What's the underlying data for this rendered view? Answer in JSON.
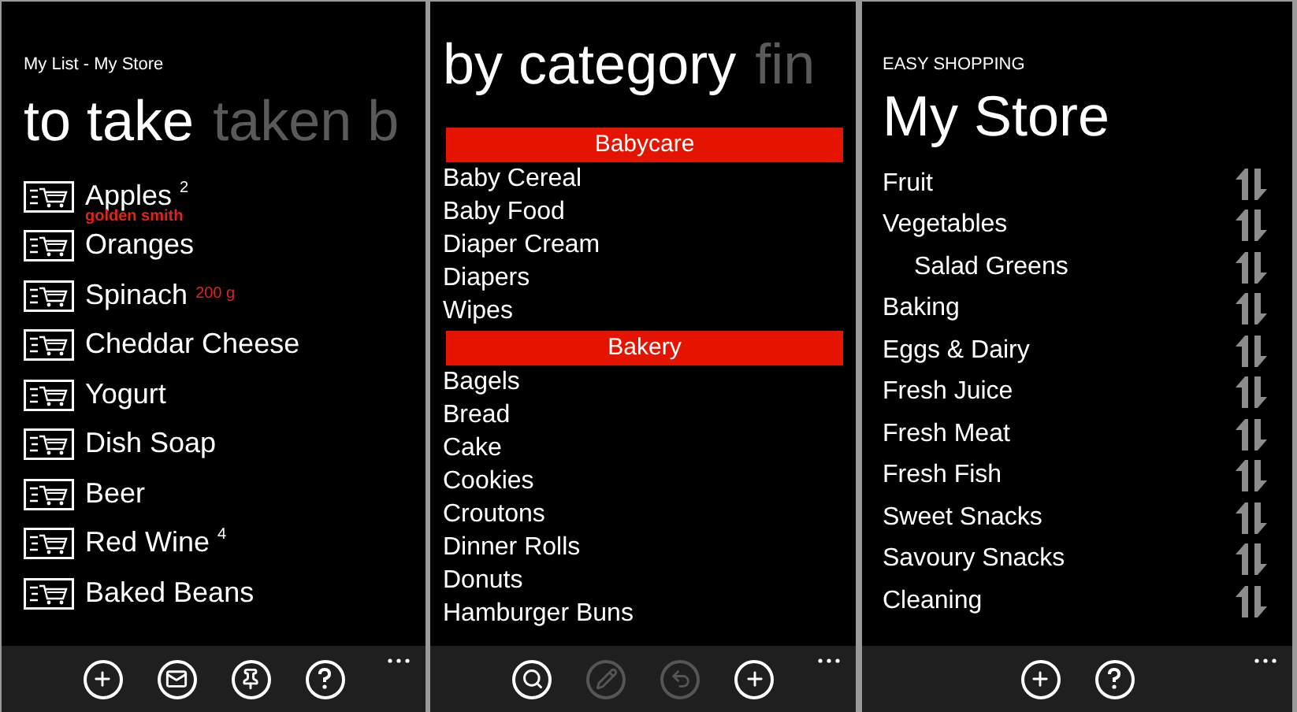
{
  "screens": [
    {
      "app_title": "My List - My Store",
      "pivots": [
        {
          "label": "to take",
          "selected": true
        },
        {
          "label": "taken b",
          "selected": false
        }
      ],
      "items": [
        {
          "name": "Apples",
          "quantity": "2",
          "note": "golden smith"
        },
        {
          "name": "Oranges"
        },
        {
          "name": "Spinach",
          "detail": "200 g"
        },
        {
          "name": "Cheddar Cheese"
        },
        {
          "name": "Yogurt"
        },
        {
          "name": "Dish Soap"
        },
        {
          "name": "Beer"
        },
        {
          "name": "Red Wine",
          "quantity": "4"
        },
        {
          "name": "Baked Beans"
        }
      ],
      "app_bar": [
        {
          "kind": "add",
          "disabled": false
        },
        {
          "kind": "mail",
          "disabled": false
        },
        {
          "kind": "pin",
          "disabled": false
        },
        {
          "kind": "help",
          "disabled": false
        }
      ]
    },
    {
      "pivots": [
        {
          "label": "by category",
          "selected": true
        },
        {
          "label": "fin",
          "selected": false
        }
      ],
      "groups": [
        {
          "category": "Babycare",
          "items": [
            "Baby Cereal",
            "Baby Food",
            "Diaper Cream",
            "Diapers",
            "Wipes"
          ]
        },
        {
          "category": "Bakery",
          "items": [
            "Bagels",
            "Bread",
            "Cake",
            "Cookies",
            "Croutons",
            "Dinner Rolls",
            "Donuts",
            "Hamburger Buns"
          ]
        }
      ],
      "app_bar": [
        {
          "kind": "search",
          "disabled": false
        },
        {
          "kind": "edit",
          "disabled": true
        },
        {
          "kind": "undo",
          "disabled": true
        },
        {
          "kind": "add",
          "disabled": false
        }
      ]
    },
    {
      "app_title": "EASY SHOPPING",
      "page_title": "My Store",
      "aisles": [
        {
          "name": "Fruit"
        },
        {
          "name": "Vegetables",
          "children": [
            {
              "name": "Salad Greens"
            }
          ]
        },
        {
          "name": "Baking"
        },
        {
          "name": "Eggs & Dairy"
        },
        {
          "name": "Fresh Juice"
        },
        {
          "name": "Fresh Meat"
        },
        {
          "name": "Fresh Fish"
        },
        {
          "name": "Sweet Snacks"
        },
        {
          "name": "Savoury Snacks"
        },
        {
          "name": "Cleaning"
        }
      ],
      "app_bar": [
        {
          "kind": "add",
          "disabled": false
        },
        {
          "kind": "help",
          "disabled": false
        }
      ]
    }
  ]
}
